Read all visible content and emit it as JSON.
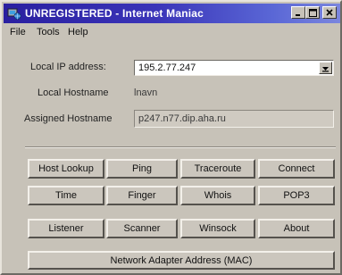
{
  "window": {
    "title": "UNREGISTERED - Internet Maniac"
  },
  "menu": {
    "items": [
      "File",
      "Tools",
      "Help"
    ]
  },
  "fields": {
    "local_ip_label": "Local IP address:",
    "local_ip_value": "195.2.77.247",
    "local_hostname_label": "Local Hostname",
    "local_hostname_value": "lnavn",
    "assigned_hostname_label": "Assigned Hostname",
    "assigned_hostname_value": "p247.n77.dip.aha.ru"
  },
  "buttons": {
    "row1": [
      "Host Lookup",
      "Ping",
      "Traceroute",
      "Connect"
    ],
    "row2": [
      "Time",
      "Finger",
      "Whois",
      "POP3"
    ],
    "row3": [
      "Listener",
      "Scanner",
      "Winsock",
      "About"
    ],
    "mac": "Network Adapter Address (MAC)"
  },
  "colors": {
    "titlebar_start": "#2a1fa0",
    "titlebar_end": "#7b86de",
    "face": "#c7c2b8"
  },
  "icons": {
    "app": "globe-network-icon",
    "minimize": "minimize-icon",
    "maximize": "maximize-icon",
    "close": "close-icon",
    "dropdown": "chevron-down-icon"
  }
}
